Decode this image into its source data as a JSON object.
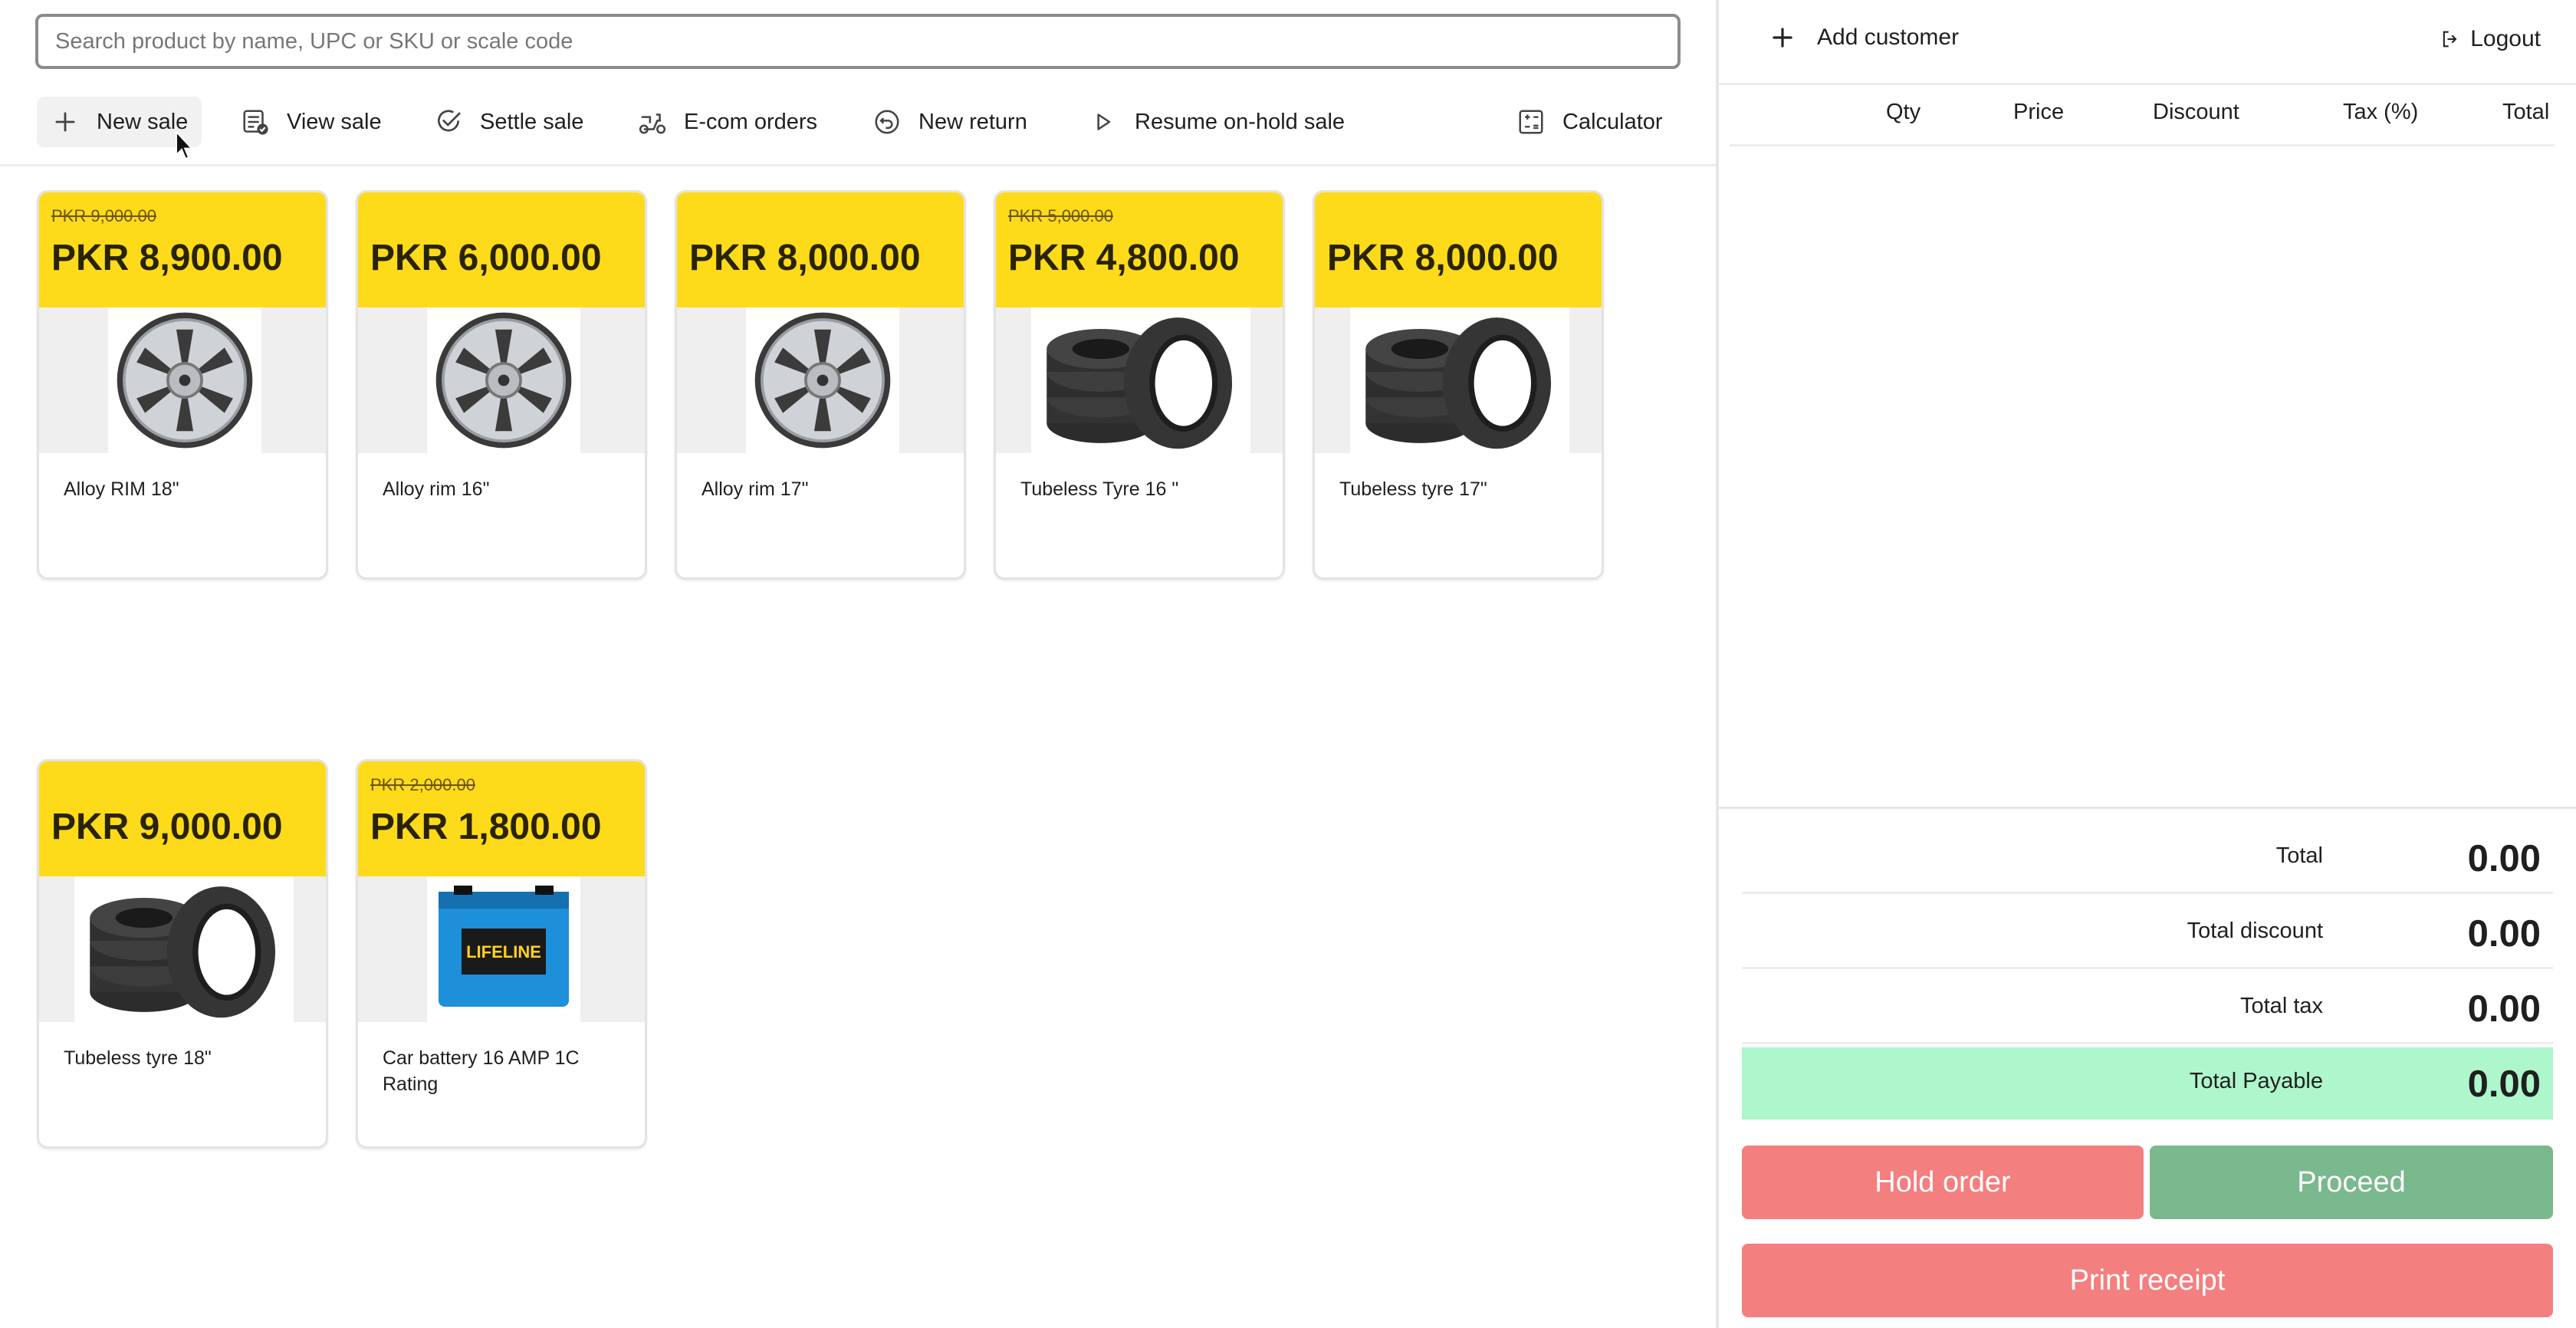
{
  "search": {
    "placeholder": "Search product by name, UPC or SKU or scale code",
    "value": ""
  },
  "toolbar": {
    "new_sale": "New sale",
    "view_sale": "View sale",
    "settle_sale": "Settle sale",
    "ecom_orders": "E-com orders",
    "new_return": "New return",
    "resume": "Resume on-hold sale",
    "calculator": "Calculator"
  },
  "products": [
    {
      "old_price": "PKR 9,000.00",
      "price": "PKR 8,900.00",
      "name": "Alloy RIM 18\"",
      "image": "alloy-rim-image"
    },
    {
      "old_price": "",
      "price": "PKR 6,000.00",
      "name": "Alloy rim 16\"",
      "image": "alloy-rim-image"
    },
    {
      "old_price": "",
      "price": "PKR 8,000.00",
      "name": "Alloy rim 17\"",
      "image": "alloy-rim-image"
    },
    {
      "old_price": "PKR 5,000.00",
      "price": "PKR 4,800.00",
      "name": "Tubeless Tyre 16 \"",
      "image": "tyre-stack-image"
    },
    {
      "old_price": "",
      "price": "PKR 8,000.00",
      "name": "Tubeless tyre 17\"",
      "image": "tyre-stack-image"
    },
    {
      "old_price": "",
      "price": "PKR 9,000.00",
      "name": "Tubeless tyre 18\"",
      "image": "tyre-stack-image"
    },
    {
      "old_price": "PKR 2,000.00",
      "price": "PKR 1,800.00",
      "name": "Car battery 16 AMP 1C Rating",
      "image": "car-battery-image",
      "image_text": "LIFELINE"
    }
  ],
  "customer": {
    "add_label": "Add customer",
    "logout_label": "Logout"
  },
  "cart": {
    "columns": [
      "Qty",
      "Price",
      "Discount",
      "Tax (%)",
      "Total"
    ]
  },
  "summary": {
    "total_label": "Total",
    "total": "0.00",
    "discount_label": "Total discount",
    "discount": "0.00",
    "tax_label": "Total tax",
    "tax": "0.00",
    "payable_label": "Total Payable",
    "payable": "0.00"
  },
  "actions": {
    "hold": "Hold order",
    "proceed": "Proceed",
    "print": "Print receipt"
  },
  "colors": {
    "price_band": "#fddb1a",
    "payable_bg": "#aef6cc",
    "hold": "#f47f7f",
    "proceed": "#7ab88e"
  }
}
